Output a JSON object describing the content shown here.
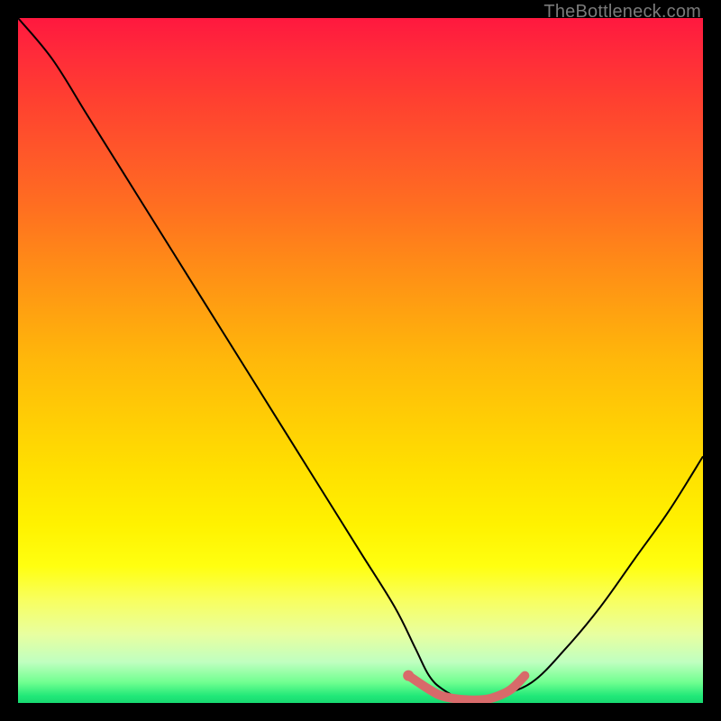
{
  "watermark": "TheBottleneck.com",
  "colors": {
    "curve_stroke": "#000000",
    "highlight_stroke": "#d86a6a",
    "background": "#000000"
  },
  "chart_data": {
    "type": "line",
    "title": "",
    "xlabel": "",
    "ylabel": "",
    "xlim": [
      0,
      100
    ],
    "ylim": [
      0,
      100
    ],
    "series": [
      {
        "name": "bottleneck-curve",
        "x": [
          0,
          5,
          10,
          15,
          20,
          25,
          30,
          35,
          40,
          45,
          50,
          55,
          58,
          60,
          62,
          65,
          68,
          70,
          75,
          80,
          85,
          90,
          95,
          100
        ],
        "values": [
          100,
          94,
          86,
          78,
          70,
          62,
          54,
          46,
          38,
          30,
          22,
          14,
          8,
          4,
          2,
          0.5,
          0.5,
          1,
          3,
          8,
          14,
          21,
          28,
          36
        ]
      },
      {
        "name": "optimal-zone-highlight",
        "x": [
          57,
          60,
          62,
          65,
          68,
          70,
          72,
          74
        ],
        "values": [
          4,
          2,
          1,
          0.5,
          0.5,
          1,
          2,
          4
        ]
      }
    ]
  }
}
